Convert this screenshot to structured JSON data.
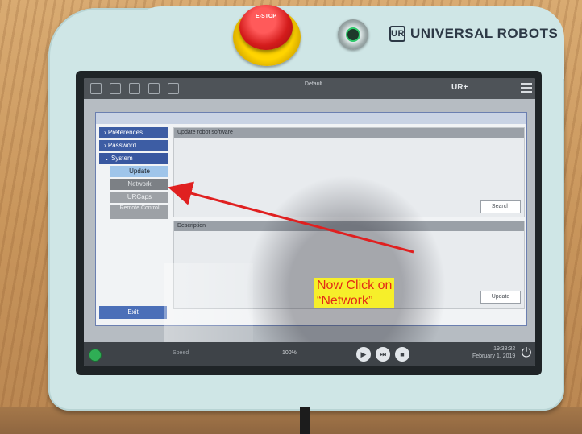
{
  "hardware": {
    "estop_label": "E-STOP",
    "brand_logo": "UR",
    "brand_name": "UNIVERSAL ROBOTS"
  },
  "topbar": {
    "mode_label": "Default",
    "ur_logo": "UR+",
    "menu_icon": "hamburger-icon"
  },
  "sidebar": {
    "items": [
      {
        "label": "Preferences",
        "expanded": false
      },
      {
        "label": "Password",
        "expanded": false
      },
      {
        "label": "System",
        "expanded": true
      }
    ],
    "subitems": [
      {
        "label": "Update",
        "state": "selected"
      },
      {
        "label": "Network",
        "state": "default"
      },
      {
        "label": "URCaps",
        "state": "default"
      },
      {
        "label": "Remote Control",
        "state": "default"
      }
    ],
    "exit_label": "Exit"
  },
  "main": {
    "update_panel_header": "Update robot software",
    "search_label": "Search",
    "description_header": "Description",
    "update_label": "Update"
  },
  "footer": {
    "speed_label": "Speed",
    "speed_value": "100%",
    "play_icon": "play-icon",
    "step_icon": "step-icon",
    "stop_icon": "stop-icon",
    "time": "19:38:32",
    "date": "February 1, 2019",
    "power_icon": "power-icon"
  },
  "annotation": {
    "line1": "Now Click on",
    "line2": "“Network”",
    "color_bg": "#f6ef2a",
    "color_text": "#e32b16",
    "arrow_color": "#e02020"
  },
  "colors": {
    "nav_blue": "#3d5da4",
    "selected_sub": "#9fc5ea",
    "pendant": "#cfe6e6"
  }
}
